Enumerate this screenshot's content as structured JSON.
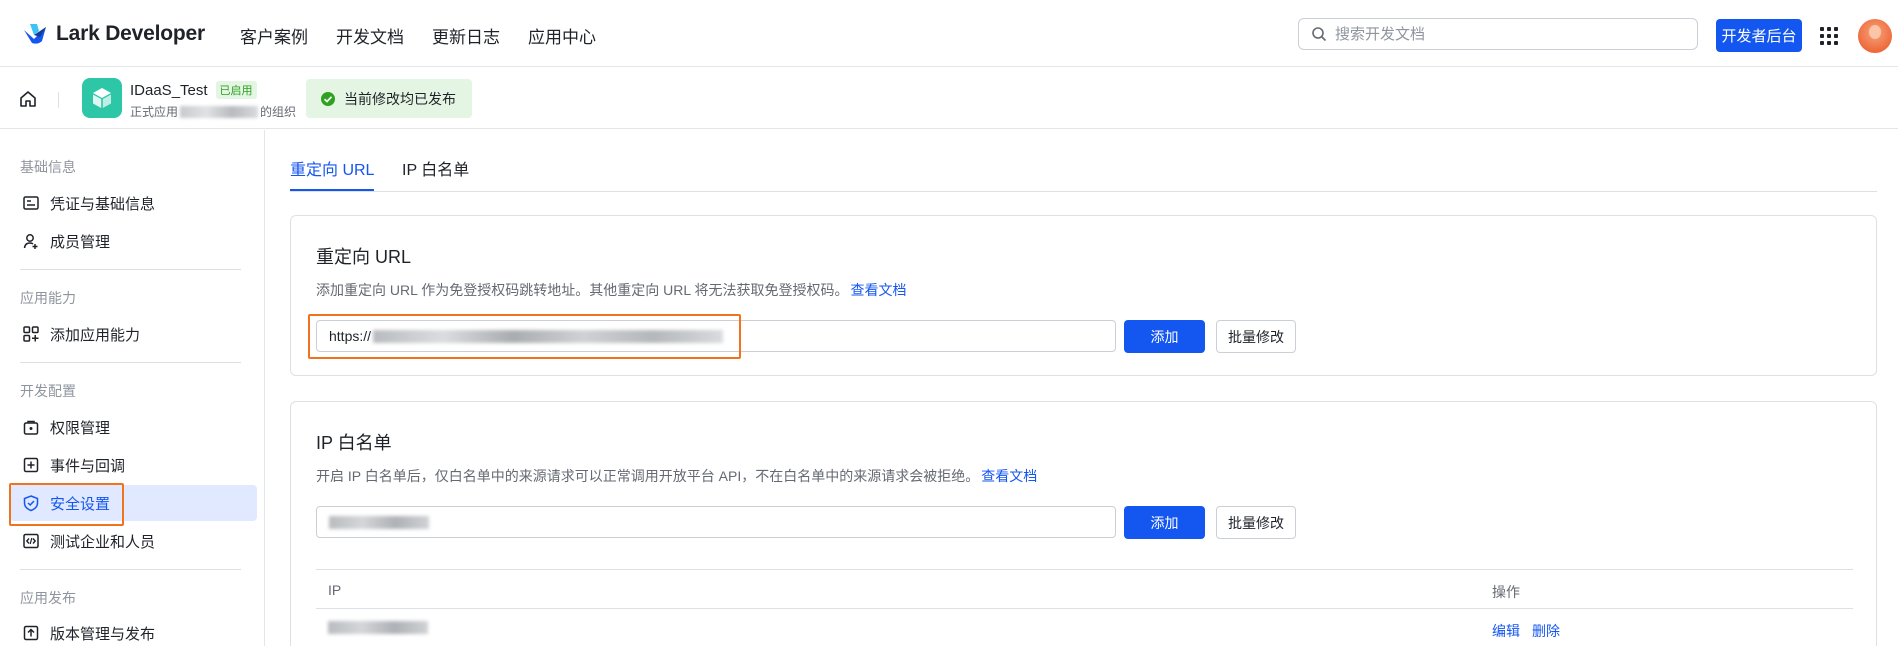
{
  "topbar": {
    "brand": "Lark Developer",
    "nav": [
      "客户案例",
      "开发文档",
      "更新日志",
      "应用中心"
    ],
    "search_placeholder": "搜索开发文档",
    "dev_console": "开发者后台"
  },
  "app": {
    "name": "IDaaS_Test",
    "status_tag": "已启用",
    "org_prefix": "正式应用",
    "org_suffix": "的组织",
    "publish_status": "当前修改均已发布"
  },
  "sidebar": {
    "sections": [
      {
        "title": "基础信息",
        "items": [
          {
            "label": "凭证与基础信息",
            "icon": "credential-icon"
          },
          {
            "label": "成员管理",
            "icon": "member-icon"
          }
        ]
      },
      {
        "title": "应用能力",
        "items": [
          {
            "label": "添加应用能力",
            "icon": "add-capability-icon"
          }
        ]
      },
      {
        "title": "开发配置",
        "items": [
          {
            "label": "权限管理",
            "icon": "permission-icon"
          },
          {
            "label": "事件与回调",
            "icon": "event-icon"
          },
          {
            "label": "安全设置",
            "icon": "shield-icon",
            "active": true
          },
          {
            "label": "测试企业和人员",
            "icon": "code-icon"
          }
        ]
      },
      {
        "title": "应用发布",
        "items": [
          {
            "label": "版本管理与发布",
            "icon": "upload-icon"
          }
        ]
      }
    ]
  },
  "tabs": [
    "重定向 URL",
    "IP 白名单"
  ],
  "redirect": {
    "title": "重定向 URL",
    "desc": "添加重定向 URL 作为免登授权码跳转地址。其他重定向 URL 将无法获取免登授权码。",
    "doc_link": "查看文档",
    "url_prefix": "https://",
    "add": "添加",
    "bulk": "批量修改"
  },
  "ipwhite": {
    "title": "IP 白名单",
    "desc": "开启 IP 白名单后，仅白名单中的来源请求可以正常调用开放平台 API，不在白名单中的来源请求会被拒绝。",
    "doc_link": "查看文档",
    "add": "添加",
    "bulk": "批量修改",
    "col_ip": "IP",
    "col_op": "操作",
    "edit": "编辑",
    "delete": "删除"
  },
  "colors": {
    "primary": "#1456f0",
    "highlight": "#f0741f",
    "success": "#2ea121"
  }
}
